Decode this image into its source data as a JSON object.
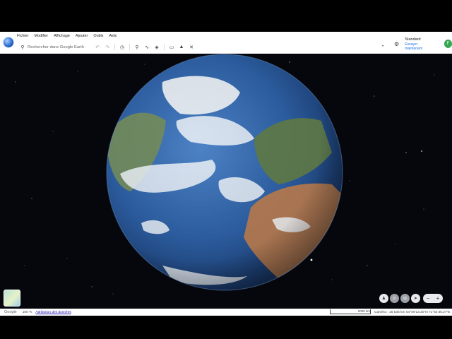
{
  "menu": {
    "items": [
      "Fichier",
      "Modifier",
      "Affichage",
      "Ajouter",
      "Outils",
      "Aide"
    ]
  },
  "toolbar": {
    "search_placeholder": "Rechercher dans Google Earth",
    "icons": [
      "undo-icon",
      "redo-icon",
      "history-icon",
      "placemark-icon",
      "path-icon",
      "layers-icon",
      "overlay-icon",
      "photo-icon",
      "measure-icon"
    ]
  },
  "account": {
    "plan": "Standard",
    "upgrade": "Essayer maintenant",
    "avatar_letter": "F"
  },
  "status": {
    "brand": "Google",
    "zoom": "100 %",
    "attribution": "Attribution des données",
    "scale": "2000 km",
    "camera": "Caméra : 16 535 km",
    "coords": "54°09'13.30\"N 71°54'35.27\"E"
  },
  "colors": {
    "accent": "#1a73e8",
    "avatar": "#34a853"
  }
}
